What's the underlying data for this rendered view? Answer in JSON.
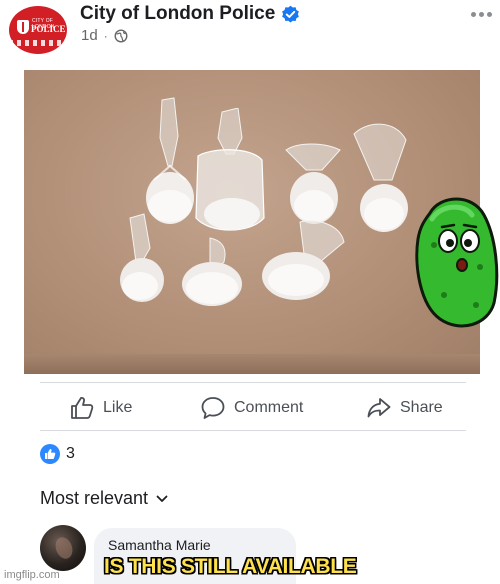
{
  "post": {
    "page_name": "City of London Police",
    "time_ago": "1d",
    "meta_separator": "·",
    "avatar_logo_text": "CITY OF LONDON POLICE",
    "icons": {
      "verified": "verified-check-icon",
      "audience": "globe-icon",
      "menu": "more-horizontal-icon"
    },
    "colors": {
      "brand": "#d21f26",
      "verified": "#1877f2",
      "secondary_text": "#65676b"
    }
  },
  "actions": {
    "like_label": "Like",
    "comment_label": "Comment",
    "share_label": "Share"
  },
  "reactions": {
    "count": "3",
    "icon": "like-badge-icon"
  },
  "comments": {
    "sort_label": "Most relevant",
    "first": {
      "author": "Samantha Marie",
      "text": "IS THIS STILL AVAILABLE"
    }
  },
  "watermark": "imgflip.com"
}
